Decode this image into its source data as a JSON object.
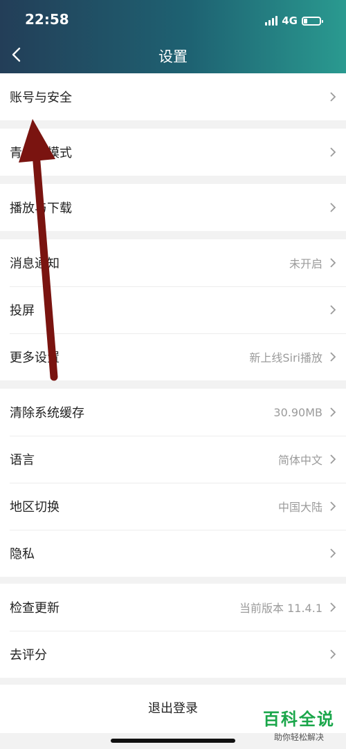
{
  "status_bar": {
    "time": "22:58",
    "network": "4G"
  },
  "nav": {
    "title": "设置"
  },
  "groups": [
    {
      "rows": [
        {
          "label": "账号与安全",
          "value": ""
        }
      ]
    },
    {
      "rows": [
        {
          "label": "青少年模式",
          "value": ""
        }
      ]
    },
    {
      "rows": [
        {
          "label": "播放与下载",
          "value": ""
        }
      ]
    },
    {
      "rows": [
        {
          "label": "消息通知",
          "value": "未开启"
        },
        {
          "label": "投屏",
          "value": ""
        },
        {
          "label": "更多设置",
          "value": "新上线Siri播放"
        }
      ]
    },
    {
      "rows": [
        {
          "label": "清除系统缓存",
          "value": "30.90MB"
        },
        {
          "label": "语言",
          "value": "简体中文"
        },
        {
          "label": "地区切换",
          "value": "中国大陆"
        },
        {
          "label": "隐私",
          "value": ""
        }
      ]
    },
    {
      "rows": [
        {
          "label": "检查更新",
          "value": "当前版本 11.4.1"
        },
        {
          "label": "去评分",
          "value": ""
        }
      ]
    }
  ],
  "logout_label": "退出登录",
  "watermark": {
    "title": "百科全说",
    "subtitle": "助你轻松解决"
  },
  "colors": {
    "header_start": "#233e58",
    "header_end": "#2a9a90",
    "annotation_arrow": "#7a1410",
    "watermark": "#1aa64a"
  }
}
